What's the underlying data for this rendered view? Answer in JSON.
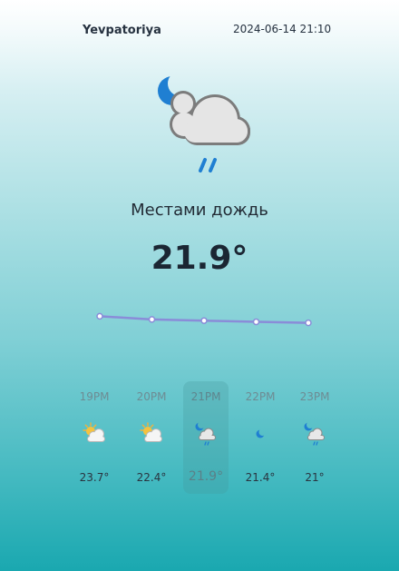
{
  "header": {
    "city": "Yevpatoriya",
    "datetime": "2024-06-14 21:10"
  },
  "current": {
    "condition": "Местами дождь",
    "temperature": "21.9°",
    "icon": "moon-cloud-rain-icon"
  },
  "trend": {
    "values": [
      23.7,
      22.4,
      21.9,
      21.4,
      21
    ]
  },
  "hourly": [
    {
      "time": "19PM",
      "temp": "23.7°",
      "icon": "sun-cloud-icon",
      "active": false
    },
    {
      "time": "20PM",
      "temp": "22.4°",
      "icon": "sun-cloud-icon",
      "active": false
    },
    {
      "time": "21PM",
      "temp": "21.9°",
      "icon": "moon-cloud-rain-icon",
      "active": true
    },
    {
      "time": "22PM",
      "temp": "21.4°",
      "icon": "moon-icon",
      "active": false
    },
    {
      "time": "23PM",
      "temp": "21°",
      "icon": "moon-cloud-rain-icon",
      "active": false
    }
  ]
}
